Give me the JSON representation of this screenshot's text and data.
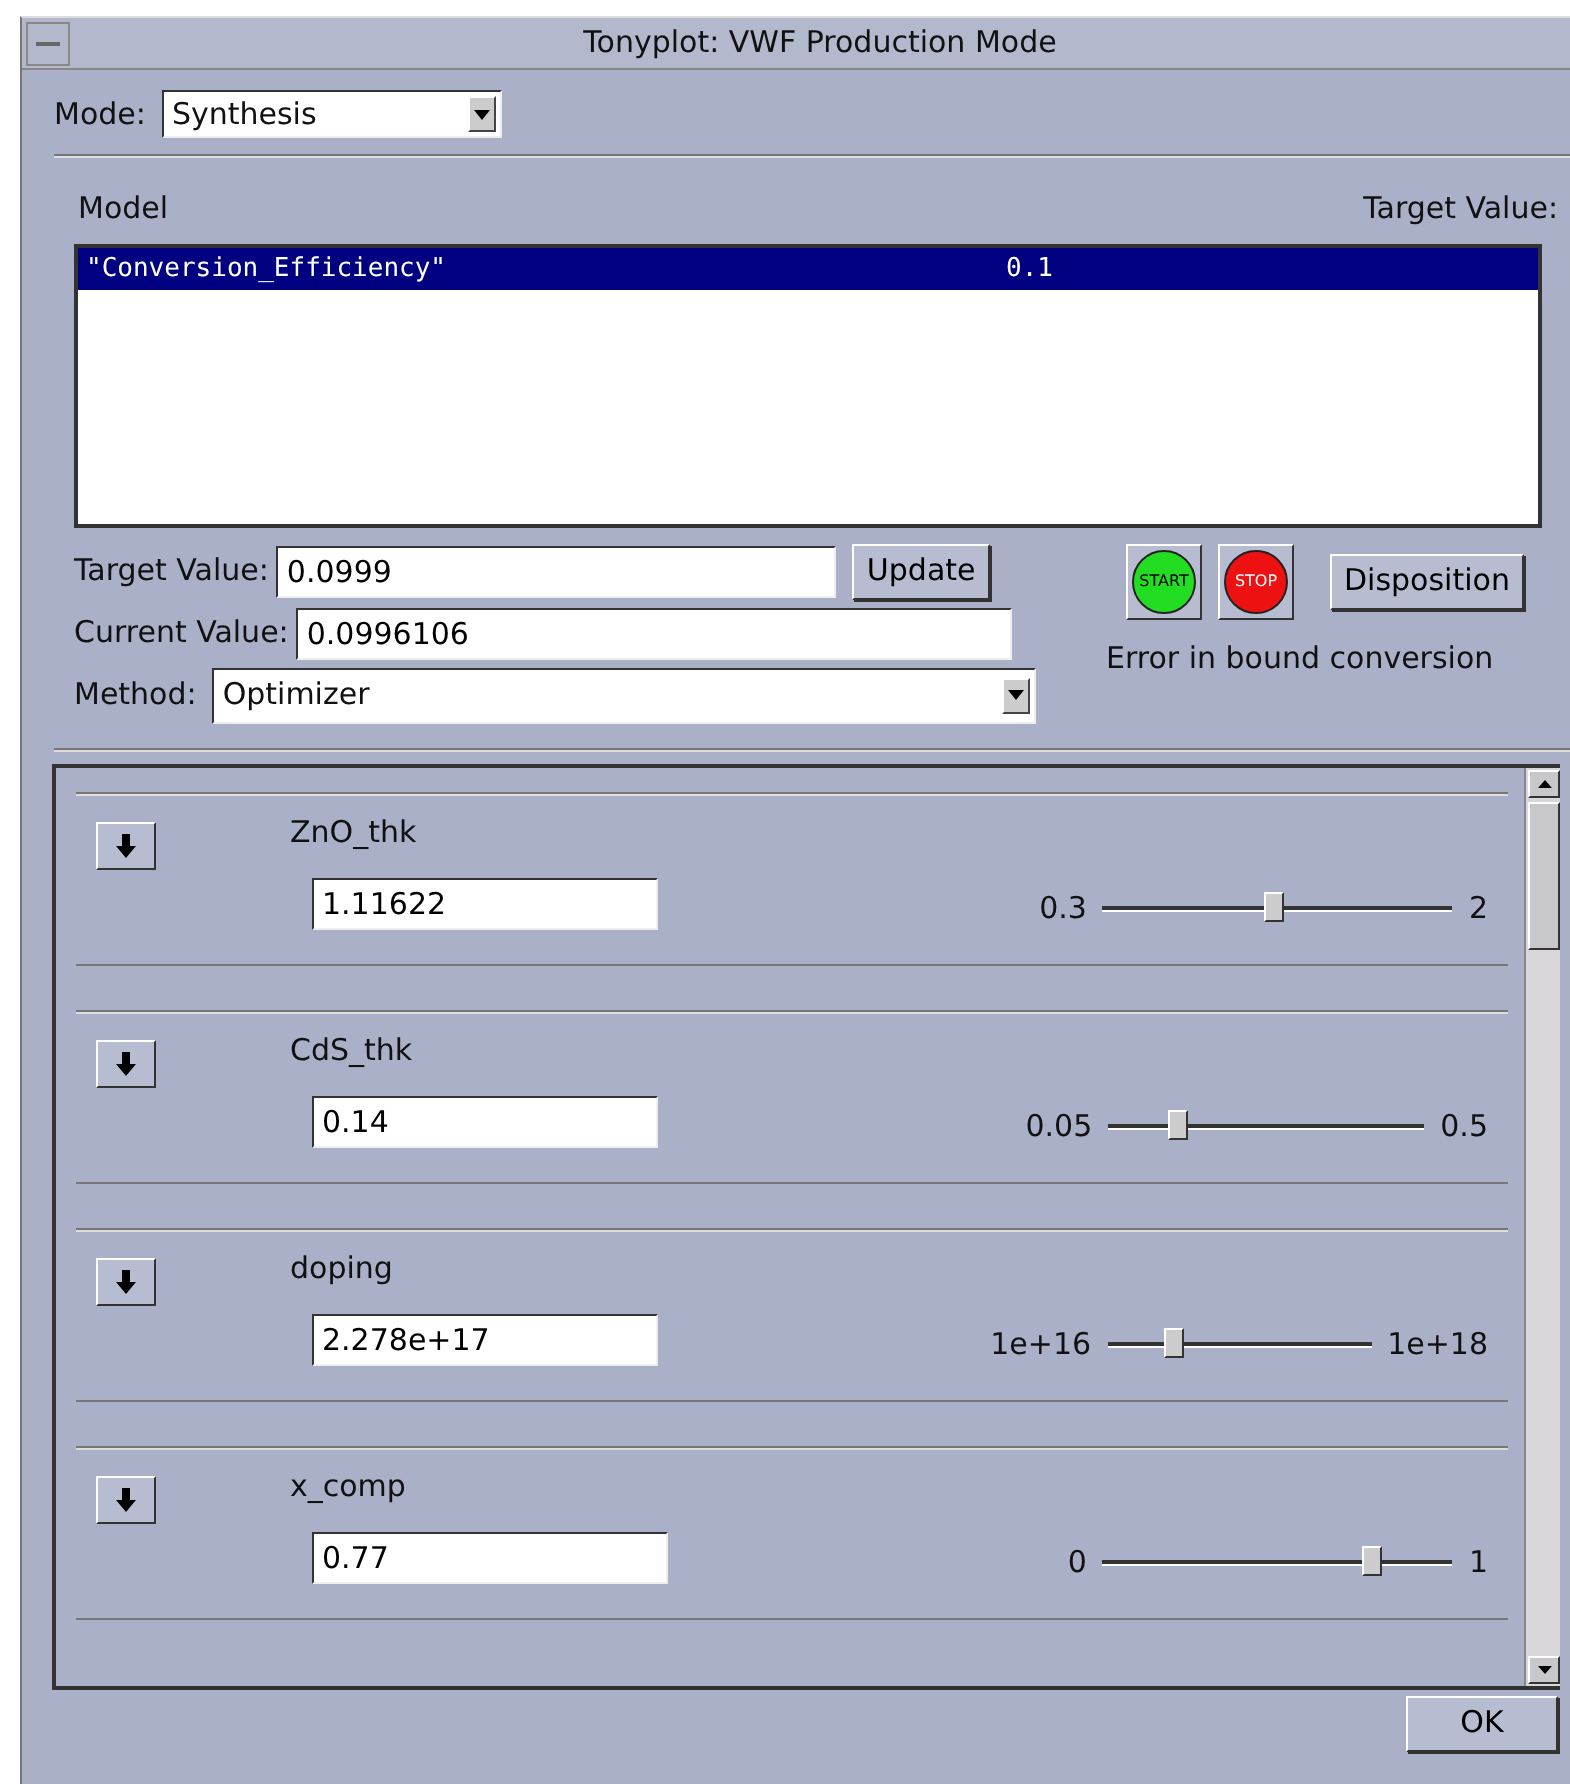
{
  "window": {
    "title": "Tonyplot: VWF Production Mode"
  },
  "mode": {
    "label": "Mode:",
    "value": "Synthesis"
  },
  "model_list": {
    "column_1": "Model",
    "column_2": "Target Value:",
    "rows": [
      {
        "name": "\"Conversion_Efficiency\"",
        "target": "0.1",
        "selected": true
      }
    ]
  },
  "target_value": {
    "label": "Target Value:",
    "value": "0.0999"
  },
  "update_button": "Update",
  "current_value": {
    "label": "Current Value:",
    "value": "0.0996106"
  },
  "method": {
    "label": "Method:",
    "value": "Optimizer"
  },
  "start_button": "START",
  "stop_button": "STOP",
  "disposition_button": "Disposition",
  "status": "Error in bound conversion",
  "parameters": [
    {
      "name": "ZnO_thk",
      "value": "1.11622",
      "min": "0.3",
      "max": "2",
      "level": 0.49
    },
    {
      "name": "CdS_thk",
      "value": "0.14",
      "min": "0.05",
      "max": "0.5",
      "level": 0.22
    },
    {
      "name": "doping",
      "value": "2.278e+17",
      "min": "1e+16",
      "max": "1e+18",
      "level": 0.25
    },
    {
      "name": "x_comp",
      "value": "0.77",
      "min": "0",
      "max": "1",
      "level": 0.77
    }
  ],
  "ok_button": "OK"
}
